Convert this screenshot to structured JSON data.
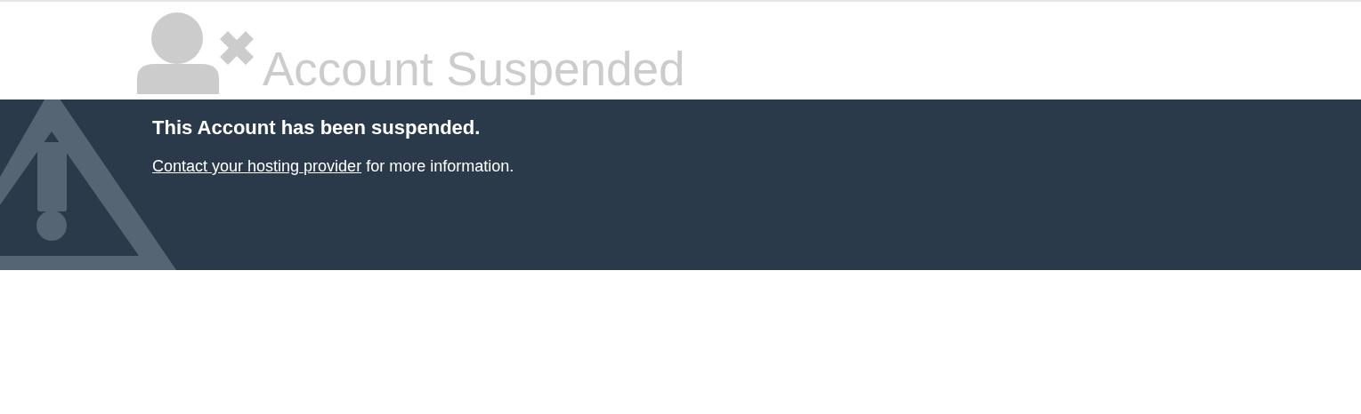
{
  "header": {
    "title": "Account Suspended"
  },
  "notice": {
    "heading": "This Account has been suspended.",
    "link": "Contact your hosting provider",
    "text": "for more information."
  }
}
